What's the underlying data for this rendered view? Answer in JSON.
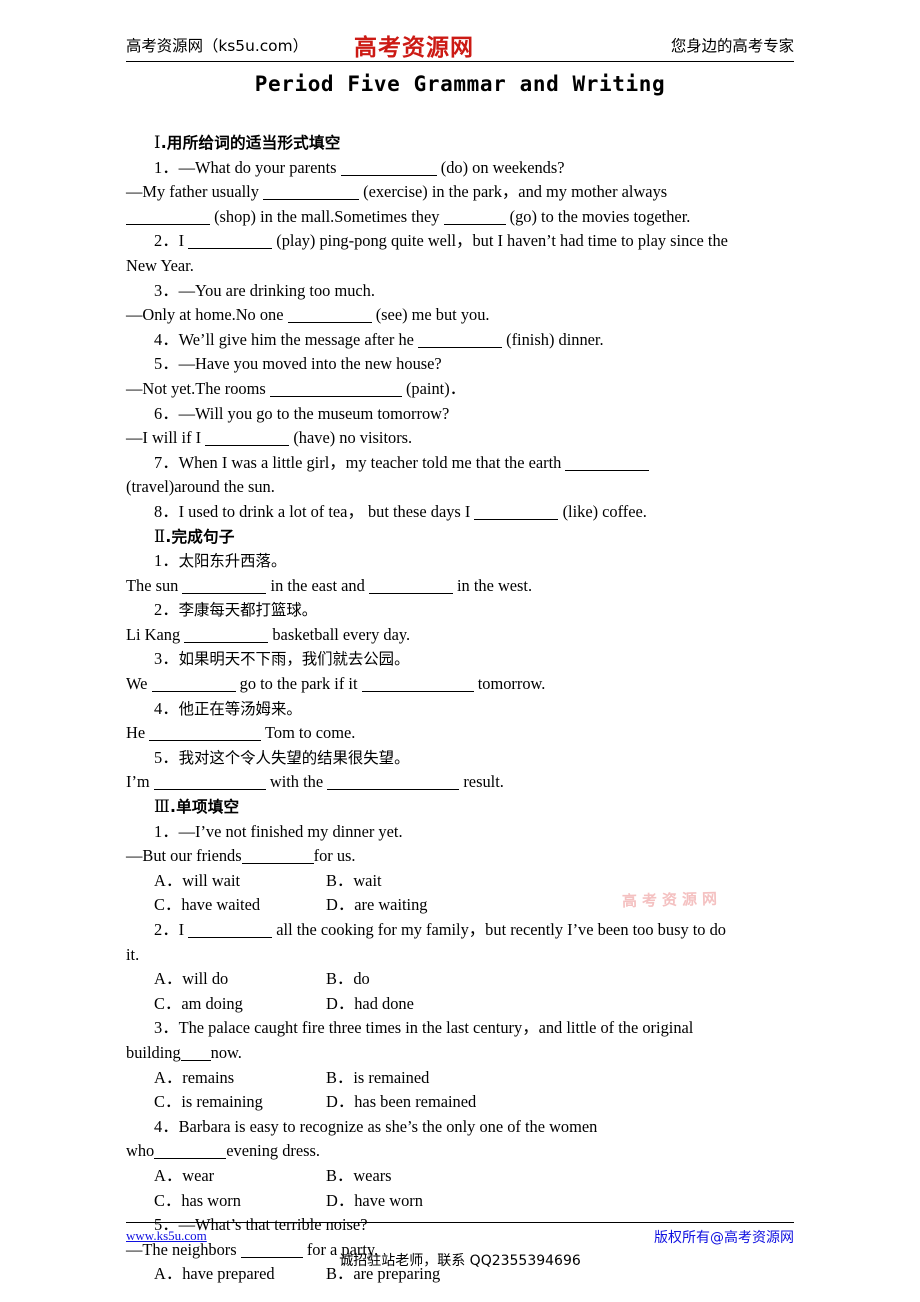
{
  "header": {
    "left_text": "高考资源网（ks5u.com）",
    "logo_text": "高考资源网",
    "logo_color": "#cc1a14",
    "right_text": "您身边的高考专家"
  },
  "title": "Period Five  Grammar and Writing",
  "sections": [
    {
      "id": "section-1",
      "number": "Ⅰ",
      "heading_cn": ".用所给词的适当形式填空",
      "items": [
        {
          "num": "1．",
          "lines": [
            "—What do your parents __________ (do) on weekends?",
            "—My father usually __________ (exercise) in the park，and my mother always",
            "________ (shop) in the mall.Sometimes they ______ (go) to the movies together."
          ]
        },
        {
          "num": "2．",
          "lines": [
            "I ________ (play) ping-pong quite well，but I haven't had time to play since the",
            "New Year."
          ]
        },
        {
          "num": "3．",
          "lines": [
            "—You are drinking too much.",
            "—Only at home.No one ________ (see) me but you."
          ]
        },
        {
          "num": "4．",
          "lines": [
            "We'll give him the message after he ________ (finish) dinner."
          ]
        },
        {
          "num": "5．",
          "lines": [
            "—Have you moved into the new house?",
            "—Not yet.The rooms ________________ (paint)．"
          ]
        },
        {
          "num": "6．",
          "lines": [
            "—Will you go to the museum tomorrow?",
            "—I will if I ________ (have) no visitors."
          ]
        },
        {
          "num": "7．",
          "lines": [
            "When I was a little girl，my teacher told me that the earth ________",
            "(travel)around the sun."
          ]
        },
        {
          "num": "8．",
          "lines": [
            "I used to drink a lot of tea，but these days I ________ (like) coffee."
          ]
        }
      ]
    },
    {
      "id": "section-2",
      "number": "Ⅱ",
      "heading_cn": ".完成句子",
      "items": [
        {
          "num": "1．",
          "cn": "太阳东升西落。",
          "en_parts": [
            "The sun ",
            " in the east and ",
            " in the west."
          ]
        },
        {
          "num": "2．",
          "cn": "李康每天都打篮球。",
          "en_parts": [
            "Li Kang ",
            " basketball every day."
          ]
        },
        {
          "num": "3．",
          "cn": "如果明天不下雨，我们就去公园。",
          "en_parts": [
            "We ",
            " go to the park if it ",
            " tomorrow."
          ]
        },
        {
          "num": "4．",
          "cn": "他正在等汤姆来。",
          "en_parts": [
            "He ",
            " Tom to come."
          ]
        },
        {
          "num": "5．",
          "cn": "我对这个令人失望的结果很失望。",
          "en_parts": [
            "I'm ",
            " with the ",
            " result."
          ]
        }
      ]
    },
    {
      "id": "section-3",
      "number": "Ⅲ",
      "heading_cn": ".单项填空",
      "items": [
        {
          "num": "1．",
          "stem_lines": [
            "—I've not finished my dinner yet.",
            "—But our friends________for us."
          ],
          "options": [
            {
              "label": "A．",
              "text": "will wait"
            },
            {
              "label": "B．",
              "text": "wait"
            },
            {
              "label": "C．",
              "text": "have waited"
            },
            {
              "label": "D．",
              "text": "are waiting"
            }
          ]
        },
        {
          "num": "2．",
          "stem_lines": [
            "I ________ all the cooking for my family，but recently I've been too busy to do",
            "it."
          ],
          "options": [
            {
              "label": "A．",
              "text": "will do"
            },
            {
              "label": "B．",
              "text": "do"
            },
            {
              "label": "C．",
              "text": "am doing"
            },
            {
              "label": "D．",
              "text": "had done"
            }
          ]
        },
        {
          "num": "3．",
          "stem_lines": [
            "The palace caught fire three times in the last century，and little of the original",
            "building____now."
          ],
          "options": [
            {
              "label": "A．",
              "text": "remains"
            },
            {
              "label": "B．",
              "text": "is remained"
            },
            {
              "label": "C．",
              "text": "is remaining"
            },
            {
              "label": "D．",
              "text": "has been remained"
            }
          ]
        },
        {
          "num": "4．",
          "stem_lines": [
            "Barbara is easy to recognize as she's the only one of the women",
            "who________evening dress."
          ],
          "options": [
            {
              "label": "A．",
              "text": "wear"
            },
            {
              "label": "B．",
              "text": "wears"
            },
            {
              "label": "C．",
              "text": "has worn"
            },
            {
              "label": "D．",
              "text": "have worn"
            }
          ]
        },
        {
          "num": "5．",
          "stem_lines": [
            "—What's that terrible noise?",
            "—The neighbors ______ for a party."
          ],
          "options": [
            {
              "label": "A．",
              "text": "have prepared"
            },
            {
              "label": "B．",
              "text": "are preparing"
            }
          ]
        }
      ]
    }
  ],
  "watermark": {
    "text": "高考资源网",
    "color": "#f3b7b7"
  },
  "footer": {
    "left_link": "www.ks5u.com",
    "right_text": "版权所有@高考资源网",
    "center_text": "诚招驻站老师，联系 QQ2355394696",
    "link_color": "#1010e0"
  }
}
